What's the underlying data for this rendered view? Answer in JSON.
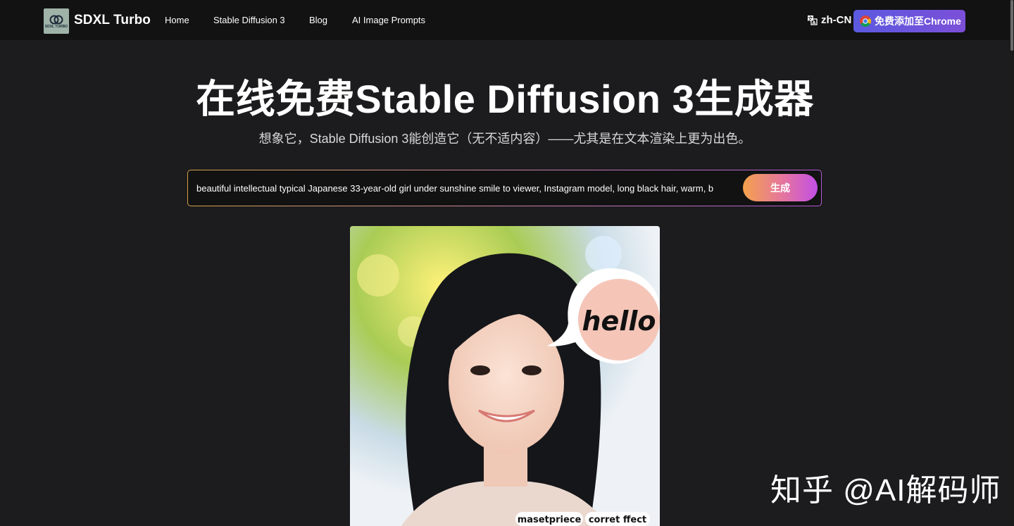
{
  "header": {
    "logo_text": "SDXL TURBO",
    "brand": "SDXL Turbo",
    "nav": [
      {
        "label": "Home"
      },
      {
        "label": "Stable Diffusion 3"
      },
      {
        "label": "Blog"
      },
      {
        "label": "AI Image Prompts"
      }
    ],
    "language": "zh-CN",
    "chrome_button": "免费添加至Chrome"
  },
  "hero": {
    "title": "在线免费Stable Diffusion 3生成器",
    "subtitle": "想象它，Stable Diffusion 3能创造它（无不适内容）——尤其是在文本渲染上更为出色。"
  },
  "prompt": {
    "value": "beautiful intellectual typical Japanese 33-year-old girl under sunshine smile to viewer, Instagram model, long black hair, warm, b",
    "button": "生成"
  },
  "image": {
    "speech_bubble": "hello",
    "tags": [
      "masetpriece",
      "corret ffect"
    ]
  },
  "watermark": "知乎 @AI解码师"
}
